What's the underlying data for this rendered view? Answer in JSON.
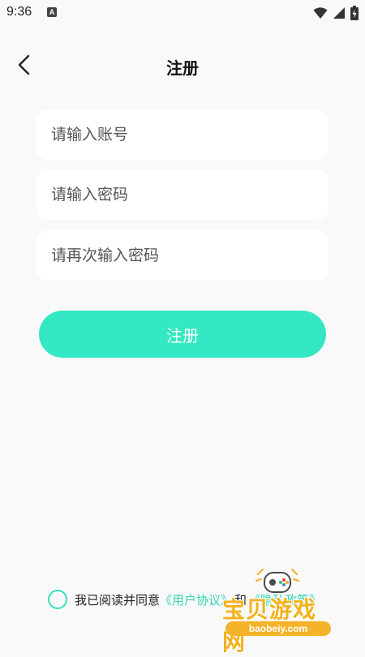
{
  "status_bar": {
    "time": "9:36",
    "notification_letter": "A"
  },
  "header": {
    "title": "注册"
  },
  "form": {
    "account_placeholder": "请输入账号",
    "password_placeholder": "请输入密码",
    "confirm_placeholder": "请再次输入密码",
    "account_value": "",
    "password_value": "",
    "confirm_value": ""
  },
  "register_button": {
    "label": "注册"
  },
  "agreement": {
    "prefix": "我已阅读并同意",
    "user_agreement": "《用户协议》",
    "and": "和",
    "privacy_policy": "《隐私政策》",
    "checked": false
  },
  "watermark": {
    "text": "宝贝游戏网",
    "url": "baobeiy.com"
  },
  "colors": {
    "accent": "#33e8c2",
    "background": "#f9f9f9",
    "field_background": "#ffffff",
    "link": "#33d6b5"
  }
}
